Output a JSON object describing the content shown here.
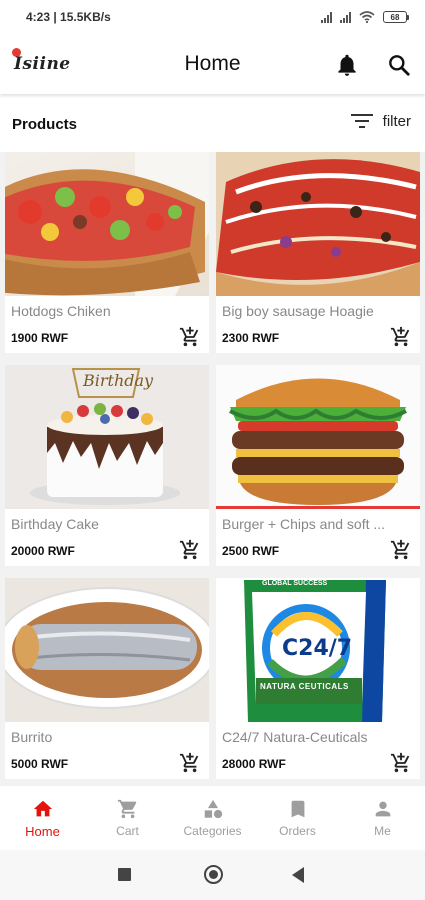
{
  "status_bar": {
    "time": "4:23 | 15.5KB/s",
    "battery": "68"
  },
  "app_bar": {
    "logo_text": "Isiine",
    "title": "Home"
  },
  "products": {
    "title": "Products",
    "filter_label": "filter"
  },
  "items": [
    {
      "name": "Hotdogs Chiken",
      "price": "1900 RWF"
    },
    {
      "name": "Big boy sausage Hoagie",
      "price": "2300 RWF"
    },
    {
      "name": "Birthday Cake",
      "price": "20000 RWF",
      "image_text": "Birthday"
    },
    {
      "name": "Burger + Chips and soft ...",
      "price": "2500 RWF"
    },
    {
      "name": "Burrito",
      "price": "5000 RWF"
    },
    {
      "name": "C24/7 Natura-Ceuticals",
      "price": "28000 RWF",
      "image_text": "C24/7",
      "image_subtext": "NATURA CEUTICALS",
      "image_brand": "GLOBAL SUCCESS"
    }
  ],
  "nav": [
    {
      "label": "Home",
      "icon": "home-icon",
      "active": true
    },
    {
      "label": "Cart",
      "icon": "cart-icon"
    },
    {
      "label": "Categories",
      "icon": "categories-icon"
    },
    {
      "label": "Orders",
      "icon": "bookmark-icon"
    },
    {
      "label": "Me",
      "icon": "person-icon"
    }
  ],
  "colors": {
    "accent": "#e3120b",
    "inactive": "#9e9e9e",
    "background": "#f2f2f2"
  }
}
